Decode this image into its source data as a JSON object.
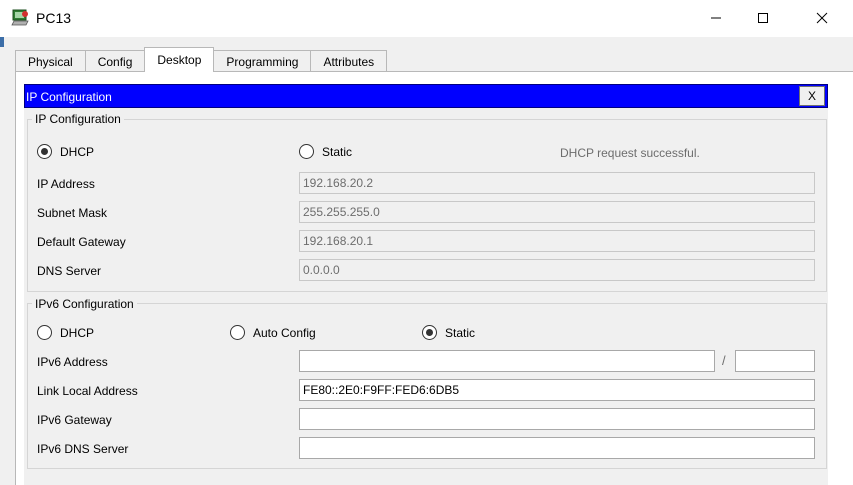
{
  "window": {
    "title": "PC13",
    "minimize_glyph": "—",
    "maximize_glyph": "☐",
    "close_glyph": "✕",
    "icon": "pc-icon"
  },
  "tabs": [
    {
      "label": "Physical",
      "active": false
    },
    {
      "label": "Config",
      "active": false
    },
    {
      "label": "Desktop",
      "active": true
    },
    {
      "label": "Programming",
      "active": false
    },
    {
      "label": "Attributes",
      "active": false
    }
  ],
  "inner_window": {
    "title": "IP Configuration",
    "close_label": "X",
    "header_color": "#0000ff"
  },
  "ipv4": {
    "group_title": "IP Configuration",
    "dhcp_label": "DHCP",
    "dhcp_checked": true,
    "static_label": "Static",
    "static_checked": false,
    "status_text": "DHCP request successful.",
    "ip_address_label": "IP Address",
    "ip_address_value": "192.168.20.2",
    "subnet_mask_label": "Subnet Mask",
    "subnet_mask_value": "255.255.255.0",
    "default_gateway_label": "Default Gateway",
    "default_gateway_value": "192.168.20.1",
    "dns_server_label": "DNS Server",
    "dns_server_value": "0.0.0.0"
  },
  "ipv6": {
    "group_title": "IPv6 Configuration",
    "dhcp_label": "DHCP",
    "dhcp_checked": false,
    "auto_config_label": "Auto Config",
    "auto_config_checked": false,
    "static_label": "Static",
    "static_checked": true,
    "ipv6_address_label": "IPv6 Address",
    "ipv6_address_value": "",
    "prefix_separator": "/",
    "prefix_value": "",
    "link_local_label": "Link Local Address",
    "link_local_value": "FE80::2E0:F9FF:FED6:6DB5",
    "ipv6_gateway_label": "IPv6 Gateway",
    "ipv6_gateway_value": "",
    "ipv6_dns_label": "IPv6 DNS Server",
    "ipv6_dns_value": ""
  }
}
